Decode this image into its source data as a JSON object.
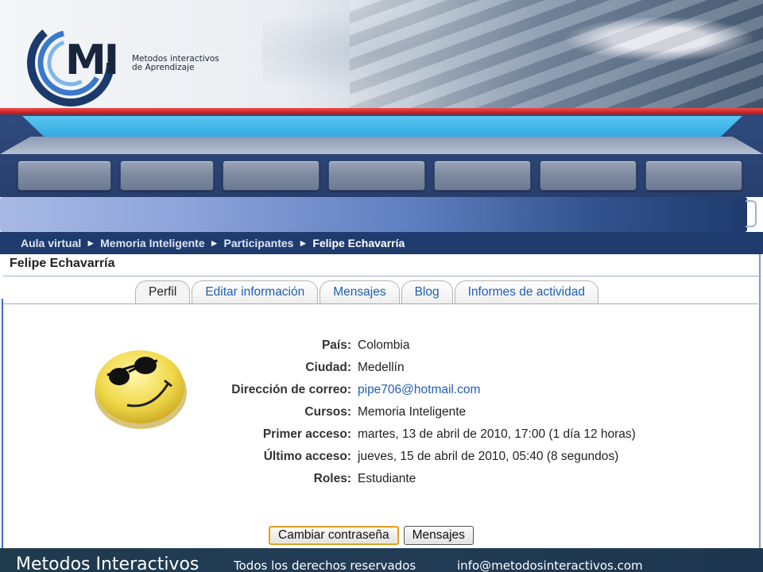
{
  "header": {
    "logo_text": "MI",
    "logo_tagline_line1": "Metodos interactivos",
    "logo_tagline_line2": "de Aprendizaje"
  },
  "breadcrumb": [
    {
      "label": "Aula virtual"
    },
    {
      "label": "Memoria Inteligente"
    },
    {
      "label": "Participantes"
    },
    {
      "label": "Felipe Echavarría"
    }
  ],
  "breadcrumb_separator": "►",
  "page": {
    "title": "Felipe Echavarría"
  },
  "tabs": [
    {
      "label": "Perfil",
      "active": true
    },
    {
      "label": "Editar información",
      "active": false
    },
    {
      "label": "Mensajes",
      "active": false
    },
    {
      "label": "Blog",
      "active": false
    },
    {
      "label": "Informes de actividad",
      "active": false
    }
  ],
  "profile": {
    "rows": [
      {
        "label": "País:",
        "value": "Colombia"
      },
      {
        "label": "Ciudad:",
        "value": "Medellín"
      },
      {
        "label": "Dirección de correo:",
        "value": "pipe706@hotmail.com"
      },
      {
        "label": "Cursos:",
        "value": "Memoria Inteligente"
      },
      {
        "label": "Primer acceso:",
        "value": "martes, 13 de abril de 2010, 17:00  (1 día 12 horas)"
      },
      {
        "label": "Último acceso:",
        "value": "jueves, 15 de abril de 2010, 05:40  (8 segundos)"
      },
      {
        "label": "Roles:",
        "value": "Estudiante"
      }
    ]
  },
  "actions": {
    "change_password": "Cambiar contraseña",
    "messages": "Mensajes"
  },
  "footer": {
    "brand": "Metodos Interactivos",
    "rights": "Todos los derechos reservados",
    "email": "info@metodosinteractivos.com"
  },
  "colors": {
    "nav_blue": "#1f3b6e",
    "accent_red": "#c41a1a",
    "link_blue": "#1f5fb4",
    "footer_bg": "#223c56"
  }
}
